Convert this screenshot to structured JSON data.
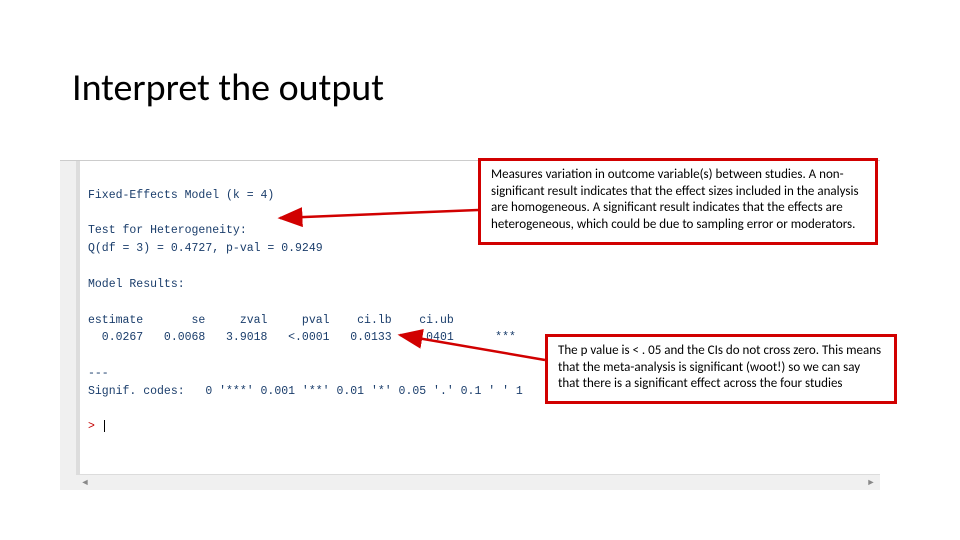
{
  "title": "Interpret the output",
  "console": {
    "line_blank_top": "",
    "line_model": "Fixed-Effects Model (k = 4)",
    "line_blank1": "",
    "line_test_hdr": "Test for Heterogeneity:",
    "line_q": "Q(df = 3) = 0.4727, p-val = 0.9249",
    "line_blank2": "",
    "line_results_hdr": "Model Results:",
    "line_blank3": "",
    "line_cols": "estimate       se     zval     pval    ci.lb    ci.ub          ",
    "line_vals": "  0.0267   0.0068   3.9018   <.0001   0.0133   0.0401      *** ",
    "line_blank4": "",
    "line_dash": "---",
    "line_signif": "Signif. codes:   0 '***' 0.001 '**' 0.01 '*' 0.05 '.' 0.1 ' ' 1",
    "line_blank5": "",
    "prompt": "> "
  },
  "callout1": "Measures variation in outcome variable(s) between studies. A non-significant result indicates that the effect sizes included in the analysis are homogeneous. A significant result indicates that the effects are heterogeneous, which could be due to sampling error or moderators.",
  "callout2": "The p value is < . 05 and the CIs do not cross zero. This means that the meta-analysis is significant (woot!) so we can say that there is a significant effect across the four studies"
}
